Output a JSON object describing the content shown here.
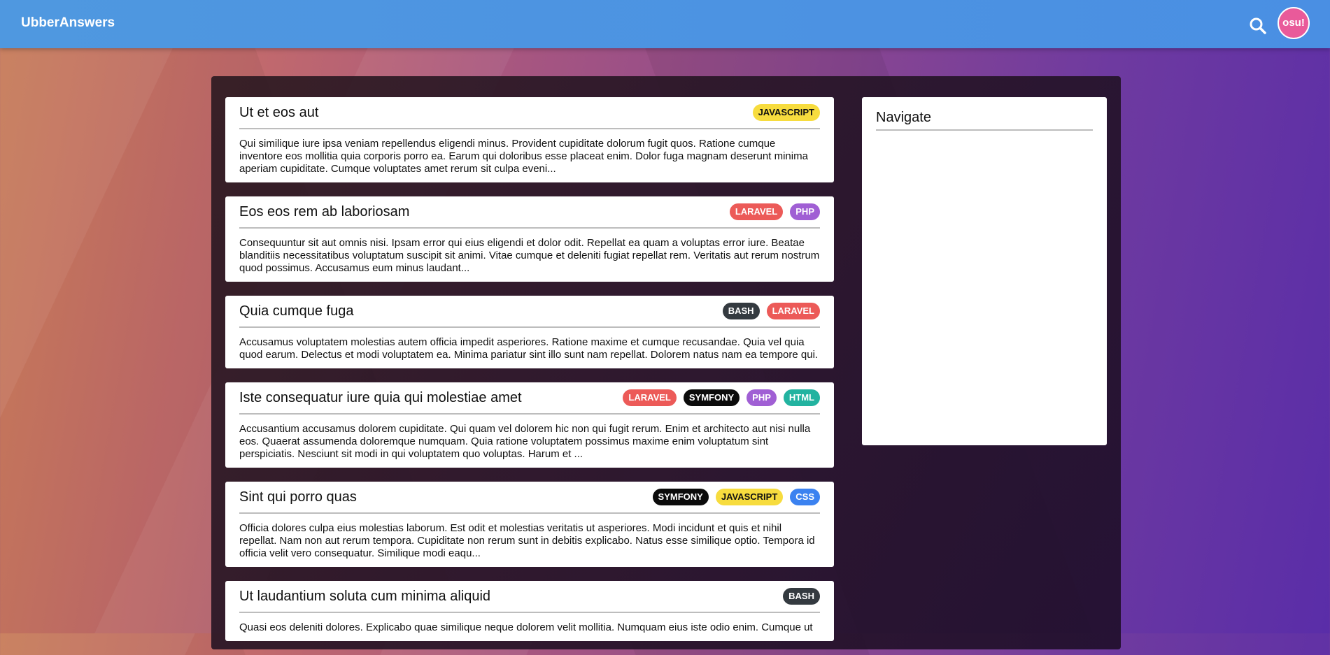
{
  "header": {
    "brand": "UbberAnswers",
    "avatar_text": "osu!"
  },
  "tag_colors": {
    "JAVASCRIPT": {
      "bg": "#f7dc3e",
      "fg": "#111111"
    },
    "LARAVEL": {
      "bg": "#ec5a58",
      "fg": "#ffffff"
    },
    "PHP": {
      "bg": "#a05fd4",
      "fg": "#ffffff"
    },
    "BASH": {
      "bg": "#343a40",
      "fg": "#ffffff"
    },
    "SYMFONY": {
      "bg": "#0b0b0b",
      "fg": "#ffffff"
    },
    "HTML": {
      "bg": "#22b3a0",
      "fg": "#ffffff"
    },
    "CSS": {
      "bg": "#3b82f0",
      "fg": "#ffffff"
    }
  },
  "posts": [
    {
      "title": "Ut et eos aut",
      "tags": [
        "JAVASCRIPT"
      ],
      "excerpt": "Qui similique iure ipsa veniam repellendus eligendi minus. Provident cupiditate dolorum fugit quos. Ratione cumque inventore eos mollitia quia corporis porro ea. Earum qui doloribus esse placeat enim. Dolor fuga magnam deserunt minima aperiam cupiditate. Cumque voluptates amet rerum sit culpa eveni..."
    },
    {
      "title": "Eos eos rem ab laboriosam",
      "tags": [
        "LARAVEL",
        "PHP"
      ],
      "excerpt": "Consequuntur sit aut omnis nisi. Ipsam error qui eius eligendi et dolor odit. Repellat ea quam a voluptas error iure. Beatae blanditiis necessitatibus voluptatum suscipit sit animi. Vitae cumque et deleniti fugiat repellat rem. Veritatis aut rerum nostrum quod possimus. Accusamus eum minus laudant..."
    },
    {
      "title": "Quia cumque fuga",
      "tags": [
        "BASH",
        "LARAVEL"
      ],
      "excerpt": "Accusamus voluptatem molestias autem officia impedit asperiores. Ratione maxime et cumque recusandae. Quia vel quia quod earum. Delectus et modi voluptatem ea. Minima pariatur sint illo sunt nam repellat. Dolorem natus nam ea tempore qui."
    },
    {
      "title": "Iste consequatur iure quia qui molestiae amet",
      "tags": [
        "LARAVEL",
        "SYMFONY",
        "PHP",
        "HTML"
      ],
      "excerpt": "Accusantium accusamus dolorem cupiditate. Qui quam vel dolorem hic non qui fugit rerum. Enim et architecto aut nisi nulla eos. Quaerat assumenda doloremque numquam. Quia ratione voluptatem possimus maxime enim voluptatum sint perspiciatis. Nesciunt sit modi in qui voluptatem quo voluptas. Harum et ..."
    },
    {
      "title": "Sint qui porro quas",
      "tags": [
        "SYMFONY",
        "JAVASCRIPT",
        "CSS"
      ],
      "excerpt": "Officia dolores culpa eius molestias laborum. Est odit et molestias veritatis ut asperiores. Modi incidunt et quis et nihil repellat. Nam non aut rerum tempora. Cupiditate non rerum sunt in debitis explicabo. Natus esse similique optio. Tempora id officia velit vero consequatur. Similique modi eaqu..."
    },
    {
      "title": "Ut laudantium soluta cum minima aliquid",
      "tags": [
        "BASH"
      ],
      "excerpt": "Quasi eos deleniti dolores. Explicabo quae similique neque dolorem velit mollitia. Numquam eius iste odio enim. Cumque ut"
    }
  ],
  "sidebar": {
    "title": "Navigate"
  }
}
